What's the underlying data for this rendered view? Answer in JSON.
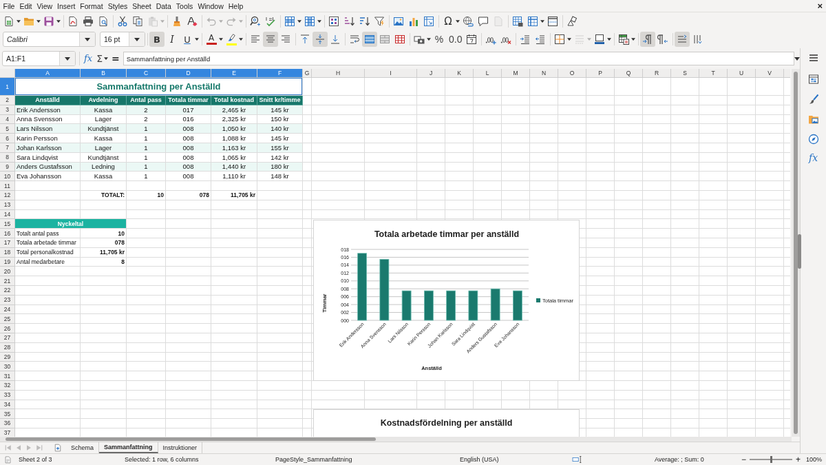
{
  "menu": [
    "File",
    "Edit",
    "View",
    "Insert",
    "Format",
    "Styles",
    "Sheet",
    "Data",
    "Tools",
    "Window",
    "Help"
  ],
  "close_document": "×",
  "standard_toolbar": {
    "special_character": "Ω",
    "paste_disabled": true,
    "undo_disabled": true,
    "redo_disabled": true,
    "header_footer_disabled": true
  },
  "format": {
    "font": "Calibri",
    "size": "16 pt",
    "bold": {
      "label": "B",
      "selected": true
    },
    "italic": {
      "label": "I",
      "selected": false
    },
    "underline": {
      "label": "U",
      "selected": false
    },
    "font_color": {
      "label": "A",
      "color": "#c9211e"
    },
    "highlight": {
      "color": "#ffff00"
    },
    "align_left": false,
    "align_center": true,
    "align_right": false,
    "align_top": false,
    "align_middle": true,
    "align_bottom": false,
    "wrap_text": false,
    "merge_and_center": true,
    "merge_cells": false,
    "unmerge_cells": false,
    "percent": "%",
    "standard_format": "0.0",
    "line_style_disabled": true,
    "left_to_right": true,
    "right_to_left": false,
    "text_horizontal": true,
    "text_vertical": false
  },
  "formula_bar": {
    "name_box": "A1:F1",
    "function_wizard": "fx",
    "sum": "Σ",
    "formula": "=",
    "content": "Sammanfattning per Anställd"
  },
  "sidebar": {
    "functions": "fx"
  },
  "column_headers": [
    {
      "label": "A",
      "selected": true
    },
    {
      "label": "B",
      "selected": true
    },
    {
      "label": "C",
      "selected": true
    },
    {
      "label": "D",
      "selected": true
    },
    {
      "label": "E",
      "selected": true
    },
    {
      "label": "F",
      "selected": true
    },
    {
      "label": "G",
      "selected": false
    },
    {
      "label": "H",
      "selected": false
    },
    {
      "label": "I",
      "selected": false
    },
    {
      "label": "J",
      "selected": false
    },
    {
      "label": "K",
      "selected": false
    },
    {
      "label": "L",
      "selected": false
    },
    {
      "label": "M",
      "selected": false
    },
    {
      "label": "N",
      "selected": false
    },
    {
      "label": "O",
      "selected": false
    },
    {
      "label": "P",
      "selected": false
    },
    {
      "label": "Q",
      "selected": false
    },
    {
      "label": "R",
      "selected": false
    },
    {
      "label": "S",
      "selected": false
    },
    {
      "label": "T",
      "selected": false
    },
    {
      "label": "U",
      "selected": false
    },
    {
      "label": "V",
      "selected": false
    }
  ],
  "row_headers": [
    {
      "label": "1",
      "selected": true
    },
    {
      "label": "2",
      "selected": false
    },
    {
      "label": "3",
      "selected": false
    },
    {
      "label": "4",
      "selected": false
    },
    {
      "label": "5",
      "selected": false
    },
    {
      "label": "6",
      "selected": false
    },
    {
      "label": "7",
      "selected": false
    },
    {
      "label": "8",
      "selected": false
    },
    {
      "label": "9",
      "selected": false
    },
    {
      "label": "10",
      "selected": false
    },
    {
      "label": "11",
      "selected": false
    },
    {
      "label": "12",
      "selected": false
    },
    {
      "label": "13",
      "selected": false
    },
    {
      "label": "14",
      "selected": false
    },
    {
      "label": "15",
      "selected": false
    },
    {
      "label": "16",
      "selected": false
    },
    {
      "label": "17",
      "selected": false
    },
    {
      "label": "18",
      "selected": false
    },
    {
      "label": "19",
      "selected": false
    },
    {
      "label": "20",
      "selected": false
    },
    {
      "label": "21",
      "selected": false
    },
    {
      "label": "22",
      "selected": false
    },
    {
      "label": "23",
      "selected": false
    },
    {
      "label": "24",
      "selected": false
    },
    {
      "label": "25",
      "selected": false
    },
    {
      "label": "26",
      "selected": false
    },
    {
      "label": "27",
      "selected": false
    },
    {
      "label": "28",
      "selected": false
    },
    {
      "label": "29",
      "selected": false
    },
    {
      "label": "30",
      "selected": false
    },
    {
      "label": "31",
      "selected": false
    },
    {
      "label": "32",
      "selected": false
    },
    {
      "label": "33",
      "selected": false
    },
    {
      "label": "34",
      "selected": false
    },
    {
      "label": "35",
      "selected": false
    },
    {
      "label": "36",
      "selected": false
    },
    {
      "label": "37",
      "selected": false
    }
  ],
  "sheet": {
    "title": {
      "text": "Sammanfattning per Anställd",
      "selected": true
    },
    "table": {
      "columns": [
        "Anställd",
        "Avdelning",
        "Antal pass",
        "Totala timmar",
        "Total kostnad",
        "Snitt kr/timme"
      ],
      "rows": [
        [
          "Erik Andersson",
          "Kassa",
          "2",
          "017",
          "2,465 kr",
          "145 kr"
        ],
        [
          "Anna Svensson",
          "Lager",
          "2",
          "016",
          "2,325 kr",
          "150 kr"
        ],
        [
          "Lars Nilsson",
          "Kundtjänst",
          "1",
          "008",
          "1,050 kr",
          "140 kr"
        ],
        [
          "Karin Persson",
          "Kassa",
          "1",
          "008",
          "1,088 kr",
          "145 kr"
        ],
        [
          "Johan Karlsson",
          "Lager",
          "1",
          "008",
          "1,163 kr",
          "155 kr"
        ],
        [
          "Sara Lindqvist",
          "Kundtjänst",
          "1",
          "008",
          "1,065 kr",
          "142 kr"
        ],
        [
          "Anders Gustafsson",
          "Ledning",
          "1",
          "008",
          "1,440 kr",
          "180 kr"
        ],
        [
          "Eva Johansson",
          "Kassa",
          "1",
          "008",
          "1,110 kr",
          "148 kr"
        ]
      ]
    },
    "total": {
      "label": "TOTALT:",
      "values": [
        "10",
        "078",
        "11,705 kr"
      ]
    },
    "key_figures": {
      "title": "Nyckeltal",
      "rows": [
        {
          "label": "Totalt antal pass",
          "value": "10"
        },
        {
          "label": "Totala arbetade timmar",
          "value": "078"
        },
        {
          "label": "Total personalkostnad",
          "value": "11,705 kr"
        },
        {
          "label": "Antal medarbetare",
          "value": "8"
        }
      ]
    }
  },
  "charts": [
    {
      "chart_data": {
        "type": "bar",
        "title": "Totala arbetade timmar per anställd",
        "xlabel": "Anställd",
        "ylabel": "Timmar",
        "categories": [
          "Erik Andersson",
          "Anna Svensson",
          "Lars Nilsson",
          "Karin Persson",
          "Johan Karlsson",
          "Sara Lindqvist",
          "Anders Gustafsson",
          "Eva Johansson"
        ],
        "series": [
          {
            "name": "Totala timmar",
            "color": "#1a7a6e",
            "values": [
              17,
              15.5,
              7.5,
              7.5,
              7.5,
              7.5,
              8,
              7.5
            ]
          }
        ],
        "ylim": [
          0,
          18
        ],
        "yticks": [
          {
            "value": 0,
            "label": "000"
          },
          {
            "value": 2,
            "label": "002"
          },
          {
            "value": 4,
            "label": "004"
          },
          {
            "value": 6,
            "label": "006"
          },
          {
            "value": 8,
            "label": "008"
          },
          {
            "value": 10,
            "label": "010"
          },
          {
            "value": 12,
            "label": "012"
          },
          {
            "value": 14,
            "label": "014"
          },
          {
            "value": 16,
            "label": "016"
          },
          {
            "value": 18,
            "label": "018"
          }
        ],
        "grid": true
      }
    },
    {
      "title": "Kostnadsfördelning per anställd"
    }
  ],
  "sheet_bar": {
    "nav_disabled": true,
    "tabs": [
      {
        "label": "Schema",
        "selected": false
      },
      {
        "label": "Sammanfattning",
        "selected": true
      },
      {
        "label": "Instruktioner",
        "selected": false
      }
    ]
  },
  "status_bar": {
    "sheet": "Sheet 2 of 3",
    "selection": "Selected: 1 row, 6 columns",
    "page_style": "PageStyle_Sammanfattning",
    "language": "English (USA)",
    "summary": "Average: ; Sum: 0",
    "zoom_out": "−",
    "zoom_in": "+",
    "zoom": {
      "level": 0.5,
      "label": "100%"
    }
  }
}
